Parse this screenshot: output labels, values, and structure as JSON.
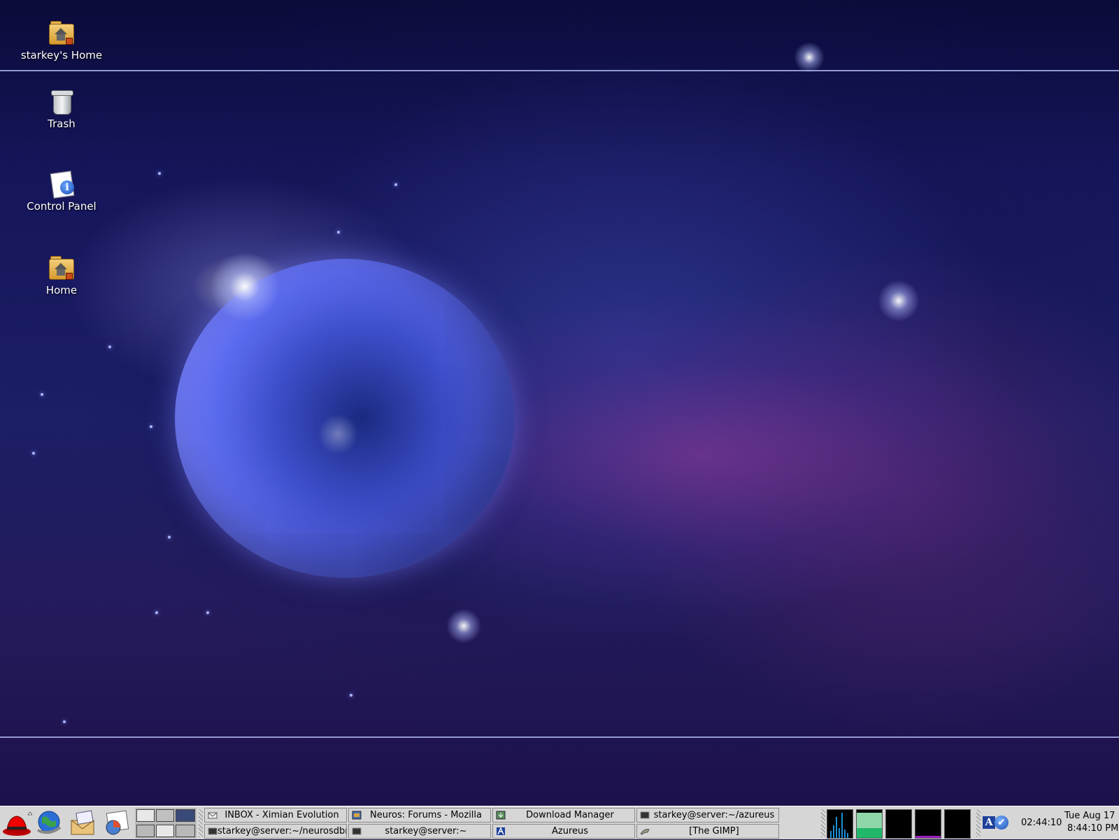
{
  "desktop": {
    "icons": [
      {
        "label": "starkey's Home",
        "icon": "home-folder-icon"
      },
      {
        "label": "Trash",
        "icon": "trash-icon"
      },
      {
        "label": "Control Panel",
        "icon": "control-panel-icon"
      },
      {
        "label": "Home",
        "icon": "home-folder-icon"
      }
    ]
  },
  "panel": {
    "launchers": [
      {
        "icon": "redhat-main-menu-icon"
      },
      {
        "icon": "web-browser-icon"
      },
      {
        "icon": "email-icon"
      },
      {
        "icon": "office-spreadsheet-icon"
      }
    ],
    "tasks": [
      {
        "label": "INBOX - Ximian Evolution",
        "icon": "mail-icon"
      },
      {
        "label": "Neuros: Forums - Mozilla",
        "icon": "mozilla-icon"
      },
      {
        "label": "Download Manager",
        "icon": "download-icon"
      },
      {
        "label": "starkey@server:~/azureus",
        "icon": "terminal-icon"
      },
      {
        "label": "starkey@server:~/neurosdbm",
        "icon": "terminal-icon"
      },
      {
        "label": "starkey@server:~",
        "icon": "terminal-icon"
      },
      {
        "label": "Azureus",
        "icon": "azureus-icon"
      },
      {
        "label": "[The GIMP]",
        "icon": "gimp-icon"
      }
    ],
    "timer": "02:44:10",
    "clock": {
      "date": "Tue Aug 17",
      "time": "8:44:10 PM"
    }
  }
}
